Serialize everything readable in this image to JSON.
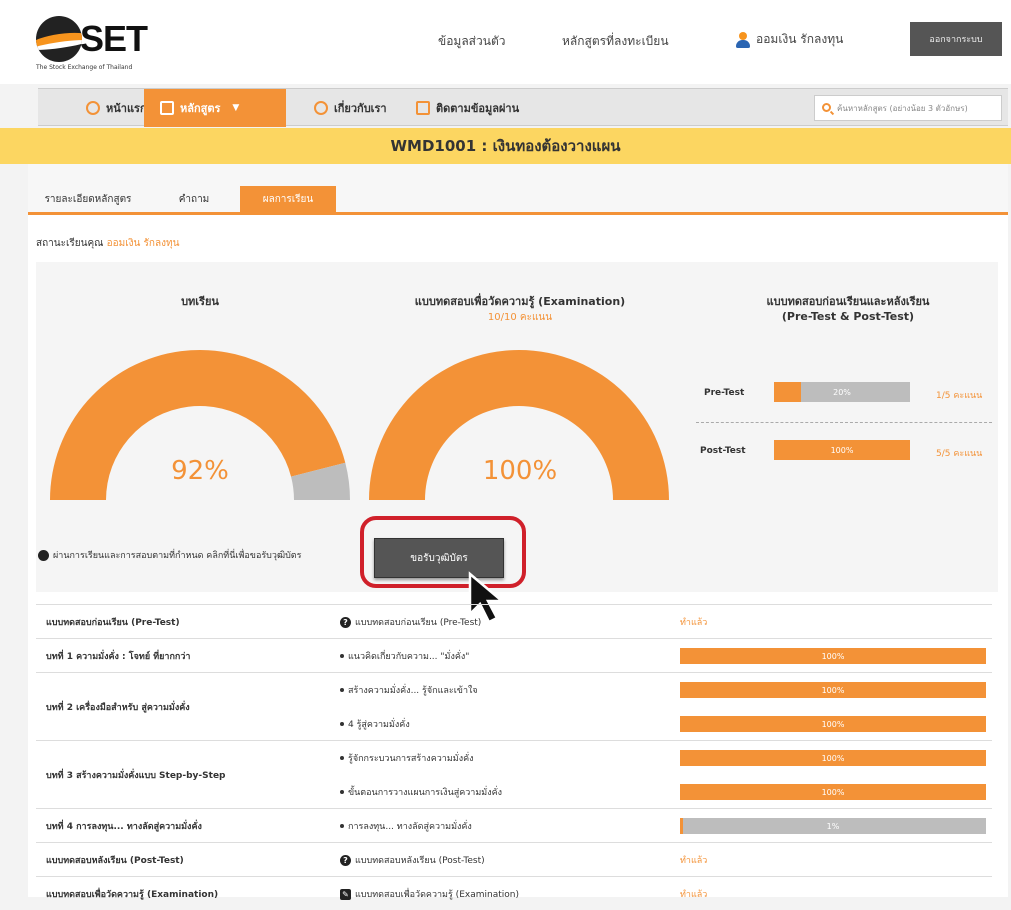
{
  "header": {
    "logo_text": "SET",
    "logo_sub": "The Stock Exchange of Thailand",
    "links": [
      "ข้อมูลส่วนตัว",
      "หลักสูตรที่ลงทะเบียน"
    ],
    "user_name": "ออมเงิน รักลงทุน",
    "logout_label": "ออกจากระบบ"
  },
  "nav": {
    "items": [
      "หน้าแรก",
      "หลักสูตร",
      "เกี่ยวกับเรา",
      "ติดตามข้อมูลผ่าน"
    ],
    "search_placeholder": "ค้นหาหลักสูตร (อย่างน้อย 3 ตัวอักษร)"
  },
  "course": {
    "title": "WMD1001 : เงินทองต้องวางแผน"
  },
  "tabs": [
    "รายละเอียดหลักสูตร",
    "คำถาม",
    "ผลการเรียน"
  ],
  "status": {
    "label": "สถานะเรียนคุณ",
    "user": "ออมเงิน รักลงทุน"
  },
  "progress": {
    "lessons": {
      "title": "บทเรียน",
      "value": 0.92,
      "display": "92%"
    },
    "exam": {
      "title": "แบบทดสอบเพื่อวัดความรู้ (Examination)",
      "sub": "10/10 คะแนน",
      "value": 1.0,
      "display": "100%"
    },
    "prepost": {
      "title_line1": "แบบทดสอบก่อนเรียนและหลังเรียน",
      "title_line2": "(Pre-Test & Post-Test)",
      "pre": {
        "label": "Pre-Test",
        "value": 0.2,
        "display": "20%",
        "count": "1/5 คะแนน"
      },
      "post": {
        "label": "Post-Test",
        "value": 1.0,
        "display": "100%",
        "count": "5/5 คะแนน"
      }
    }
  },
  "note": "ผ่านการเรียนและการสอบตามที่กำหนด คลิกที่นี่เพื่อขอรับวุฒิบัตร",
  "certificate_label": "ขอรับวุฒิบัตร",
  "table": {
    "rows": [
      {
        "title": "แบบทดสอบก่อนเรียน (Pre-Test)",
        "items": [
          {
            "icon": "question-icon",
            "text": "แบบทดสอบก่อนเรียน (Pre-Test)",
            "link": "ทำแล้ว"
          }
        ]
      },
      {
        "title": "บทที่ 1 ความมั่งคั่ง : โจทย์ ที่ยากกว่า",
        "items": [
          {
            "icon": "bullet",
            "text": "แนวคิดเกี่ยวกับความ... \"มั่งคั่ง\"",
            "progress": 1.0,
            "display": "100%"
          }
        ]
      },
      {
        "title": "บทที่ 2 เครื่องมือสำหรับ สู่ความมั่งคั่ง",
        "items": [
          {
            "icon": "bullet",
            "text": "สร้างความมั่งคั่ง... รู้จักและเข้าใจ",
            "progress": 1.0,
            "display": "100%"
          },
          {
            "icon": "bullet",
            "text": "4 รู้สู่ความมั่งคั่ง",
            "progress": 1.0,
            "display": "100%"
          }
        ]
      },
      {
        "title": "บทที่ 3 สร้างความมั่งคั่งแบบ Step-by-Step",
        "items": [
          {
            "icon": "bullet",
            "text": "รู้จักกระบวนการสร้างความมั่งคั่ง",
            "progress": 1.0,
            "display": "100%"
          },
          {
            "icon": "bullet",
            "text": "ขั้นตอนการวางแผนการเงินสู่ความมั่งคั่ง",
            "progress": 1.0,
            "display": "100%"
          }
        ]
      },
      {
        "title": "บทที่ 4 การลงทุน... ทางลัดสู่ความมั่งคั่ง",
        "items": [
          {
            "icon": "bullet",
            "text": "การลงทุน... ทางลัดสู่ความมั่งคั่ง",
            "progress": 0.01,
            "display": "1%"
          }
        ]
      },
      {
        "title": "แบบทดสอบหลังเรียน (Post-Test)",
        "items": [
          {
            "icon": "question-icon",
            "text": "แบบทดสอบหลังเรียน (Post-Test)",
            "link": "ทำแล้ว"
          }
        ]
      },
      {
        "title": "แบบทดสอบเพื่อวัดความรู้ (Examination)",
        "items": [
          {
            "icon": "exam-icon",
            "text": "แบบทดสอบเพื่อวัดความรู้ (Examination)",
            "link": "ทำแล้ว"
          }
        ]
      }
    ]
  },
  "colors": {
    "accent": "#f39237",
    "banner": "#fcd661",
    "highlight": "#d0202a",
    "track": "#bdbdbd"
  }
}
